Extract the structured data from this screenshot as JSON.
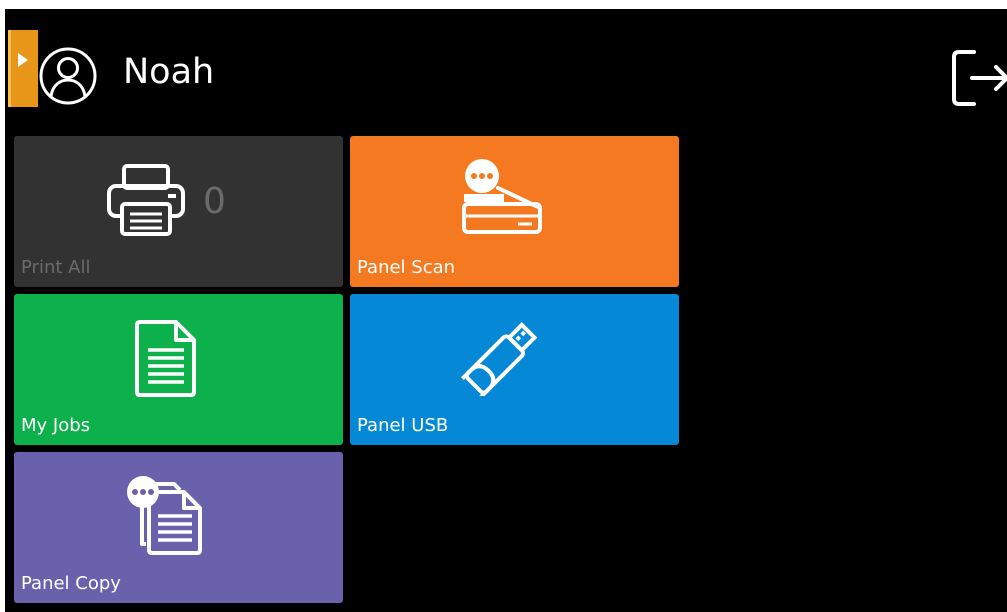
{
  "header": {
    "user_name": "Noah",
    "user_icon": "user-circle-icon",
    "logout_icon": "logout-icon",
    "side_handle_icon": "play-arrow-icon"
  },
  "tiles": [
    {
      "label": "Print All",
      "count": "0",
      "icon": "printer-icon",
      "color": "#323232"
    },
    {
      "label": "Panel Scan",
      "icon": "scanner-icon",
      "color": "#f47920"
    },
    {
      "label": "My Jobs",
      "icon": "document-icon",
      "color": "#0db14b"
    },
    {
      "label": "Panel USB",
      "icon": "usb-drive-icon",
      "color": "#0589d6"
    },
    {
      "label": "Panel Copy",
      "icon": "copy-documents-icon",
      "color": "#6a61ac"
    }
  ],
  "colors": {
    "background": "#000000",
    "accent": "#e8961a",
    "text": "#ffffff",
    "disabled_text": "#6b6b6b"
  }
}
